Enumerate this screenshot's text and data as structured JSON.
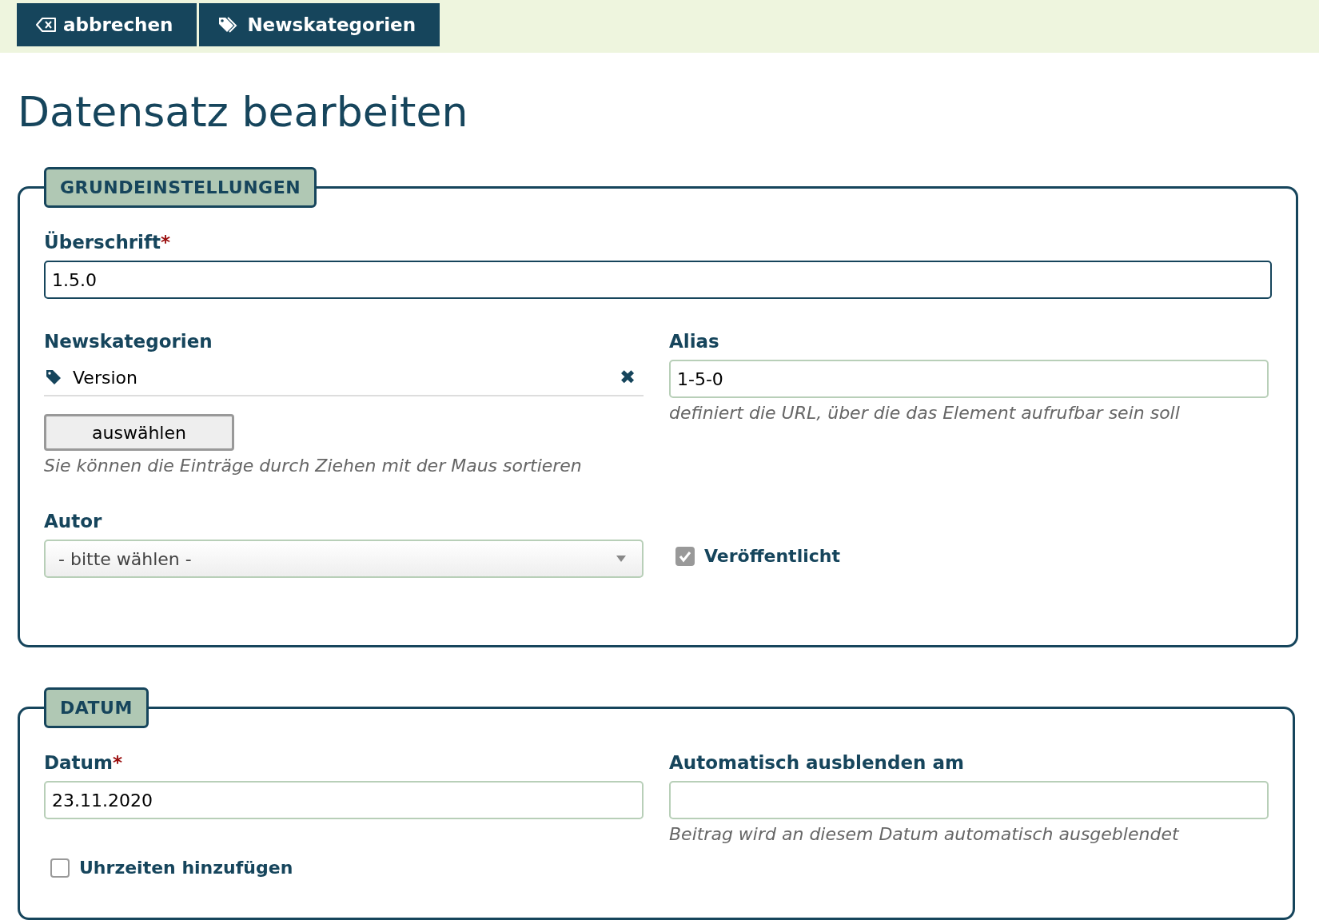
{
  "toolbar": {
    "buttons": [
      {
        "kind": "cancel",
        "label": "abbrechen"
      },
      {
        "kind": "tags",
        "label": "Newskategorien"
      }
    ]
  },
  "page_title": "Datensatz bearbeiten",
  "sections": [
    {
      "legend": "GRUNDEINSTELLUNGEN",
      "heading": {
        "label": "Überschrift",
        "required_mark": "*",
        "value": "1.5.0"
      },
      "left": [
        {
          "kind": "tags",
          "label": "Newskategorien",
          "tags": [
            {
              "label": "Version",
              "remove": "✖"
            }
          ],
          "button": "auswählen",
          "hint": "Sie können die Einträge durch Ziehen mit der Maus sortieren"
        },
        {
          "kind": "select",
          "label": "Autor",
          "value": "- bitte wählen -"
        }
      ],
      "right": [
        {
          "kind": "text",
          "label": "Alias",
          "value": "1-5-0",
          "hint": "definiert die URL, über die das Element aufrufbar sein soll"
        },
        {
          "kind": "checkbox",
          "label": "Veröffentlicht",
          "checked": true
        }
      ]
    },
    {
      "legend": "DATUM",
      "left": [
        {
          "kind": "text",
          "label": "Datum",
          "required_mark": "*",
          "value": "23.11.2020"
        },
        {
          "kind": "checkbox",
          "label": "Uhrzeiten hinzufügen",
          "checked": false
        }
      ],
      "right": [
        {
          "kind": "text",
          "label": "Automatisch ausblenden am",
          "hint": "Beitrag wird an diesem Datum automatisch ausgeblendet"
        }
      ]
    }
  ]
}
